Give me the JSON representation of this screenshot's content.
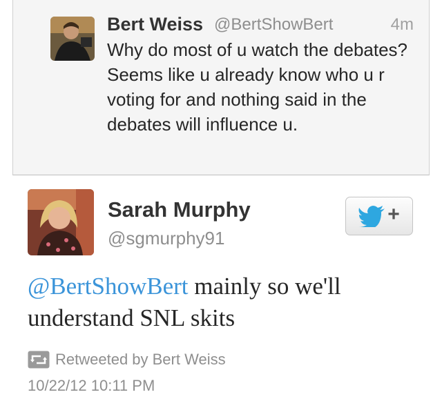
{
  "parent_tweet": {
    "author_name": "Bert Weiss",
    "author_handle": "@BertShowBert",
    "time_ago": "4m",
    "text": "Why do most of u watch the debates? Seems like u already know who u r voting for and nothing said in the debates will influence u."
  },
  "reply_tweet": {
    "author_name": "Sarah Murphy",
    "author_handle": "@sgmurphy91",
    "follow_button_icon": "twitter-bird-icon",
    "follow_button_plus": "+",
    "mention": "@BertShowBert",
    "text": " mainly so we'll understand SNL skits",
    "retweet_label": "Retweeted by Bert Weiss",
    "timestamp": "10/22/12 10:11 PM"
  },
  "colors": {
    "link_blue": "#3b94d9",
    "twitter_blue": "#2ea7e0",
    "muted_gray": "#8e8e8e"
  }
}
